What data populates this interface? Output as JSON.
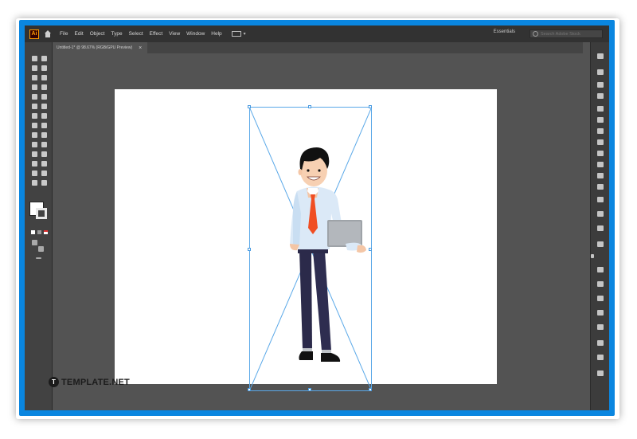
{
  "app": {
    "logo_text": "Ai"
  },
  "menu": [
    "File",
    "Edit",
    "Object",
    "Type",
    "Select",
    "Effect",
    "View",
    "Window",
    "Help"
  ],
  "workspace": {
    "label": "Essentials",
    "caret": "▾"
  },
  "search": {
    "placeholder": "Search Adobe Stock"
  },
  "document_tab": {
    "title": "Untitled-1* @ 98.67% (RGB/GPU Preview)",
    "close": "×"
  },
  "watermark": {
    "logo_letter": "T",
    "text": "TEMPLATE.NET"
  },
  "colors": {
    "accent_frame": "#0a86e0",
    "canvas": "#535353",
    "selection": "#5aa8e8",
    "tie": "#f04e23",
    "shirt": "#dbe9f7",
    "trousers": "#2b2a4a",
    "laptop": "#9ea3a8"
  },
  "illustration": {
    "subject": "businessman-with-laptop"
  }
}
